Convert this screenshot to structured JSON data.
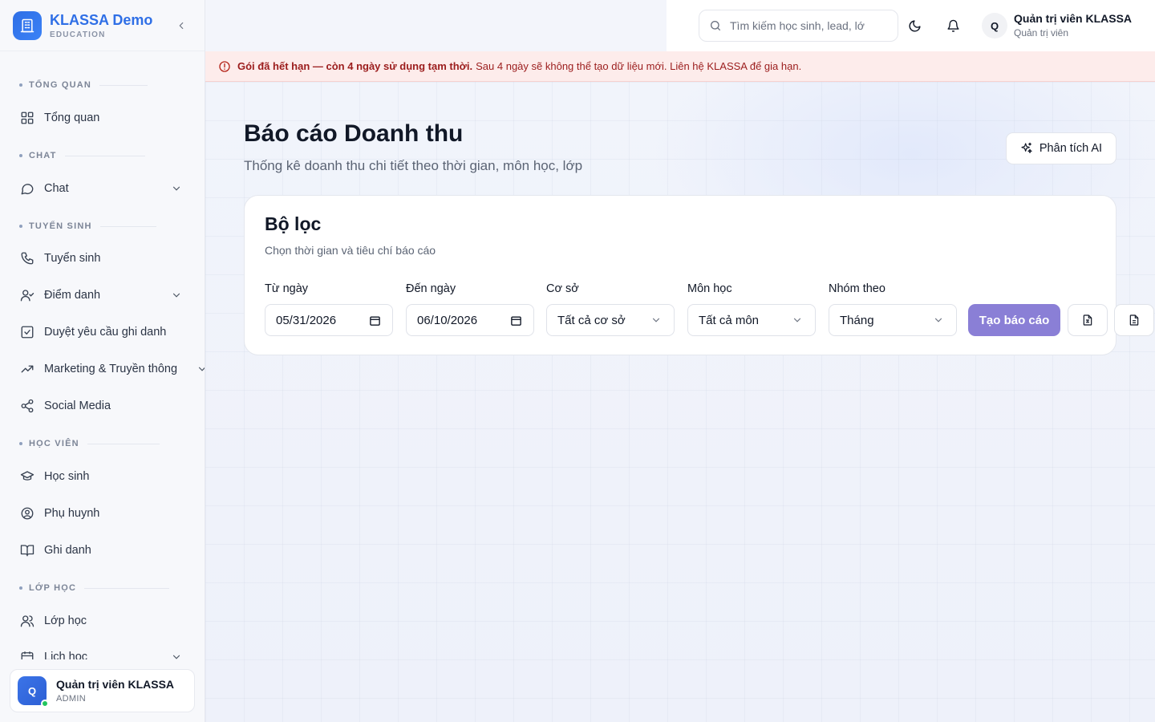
{
  "brand": {
    "title": "KLASSA Demo",
    "subtitle": "EDUCATION"
  },
  "sidebar": {
    "sections": [
      {
        "label": "TỔNG QUAN"
      },
      {
        "label": "CHAT"
      },
      {
        "label": "TUYỂN SINH"
      },
      {
        "label": "HỌC VIÊN"
      },
      {
        "label": "LỚP HỌC"
      }
    ],
    "items": [
      {
        "label": "Tổng quan",
        "icon": "grid-icon"
      },
      {
        "label": "Chat",
        "icon": "message-icon",
        "expandable": true
      },
      {
        "label": "Tuyển sinh",
        "icon": "phone-icon"
      },
      {
        "label": "Điểm danh",
        "icon": "user-check-icon",
        "expandable": true
      },
      {
        "label": "Duyệt yêu cầu ghi danh",
        "icon": "checkbox-icon"
      },
      {
        "label": "Marketing & Truyền thông",
        "icon": "trending-up-icon",
        "expandable": true
      },
      {
        "label": "Social Media",
        "icon": "share-icon"
      },
      {
        "label": "Học sinh",
        "icon": "graduation-cap-icon"
      },
      {
        "label": "Phụ huynh",
        "icon": "user-circle-icon"
      },
      {
        "label": "Ghi danh",
        "icon": "book-open-icon"
      },
      {
        "label": "Lớp học",
        "icon": "users-icon"
      },
      {
        "label": "Lịch học",
        "icon": "calendar-icon",
        "expandable": true
      }
    ],
    "user": {
      "avatar": "Q",
      "name": "Quản trị viên KLASSA",
      "role": "ADMIN"
    }
  },
  "topbar": {
    "search_placeholder": "Tìm kiếm học sinh, lead, lớ",
    "user": {
      "avatar": "Q",
      "name": "Quản trị viên KLASSA",
      "role": "Quản trị viên"
    }
  },
  "alert": {
    "bold": "Gói đã hết hạn — còn 4 ngày sử dụng tạm thời.",
    "text": "Sau 4 ngày sẽ không thể tạo dữ liệu mới. Liên hệ KLASSA để gia hạn.",
    "color": "#9b1c1c"
  },
  "page": {
    "title": "Báo cáo Doanh thu",
    "subtitle": "Thống kê doanh thu chi tiết theo thời gian, môn học, lớp",
    "ai_button": "Phân tích AI"
  },
  "filter": {
    "title": "Bộ lọc",
    "subtitle": "Chọn thời gian và tiêu chí báo cáo",
    "fields": [
      {
        "label": "Từ ngày",
        "value": "05/31/2026",
        "type": "date"
      },
      {
        "label": "Đến ngày",
        "value": "06/10/2026",
        "type": "date"
      },
      {
        "label": "Cơ sở",
        "value": "Tất cả cơ sở",
        "type": "select"
      },
      {
        "label": "Môn học",
        "value": "Tất cả môn",
        "type": "select"
      },
      {
        "label": "Nhóm theo",
        "value": "Tháng",
        "type": "select"
      }
    ],
    "generate_button": "Tạo báo cáo",
    "accent": "#8a7fd6"
  }
}
